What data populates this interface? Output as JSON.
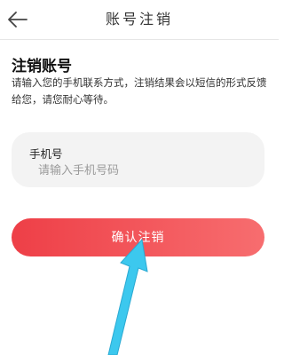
{
  "header": {
    "title": "账号注销",
    "back_icon": "back-arrow-icon"
  },
  "main": {
    "section_title": "注销账号",
    "description": "请输入您的手机联系方式，注销结果会以短信的形式反馈给您，请您耐心等待。"
  },
  "phone_field": {
    "label": "手机号",
    "placeholder": "请输入手机号码",
    "value": ""
  },
  "confirm_button": {
    "label": "确认注销"
  },
  "colors": {
    "button_gradient_start": "#ee3f47",
    "button_gradient_end": "#f76d6f",
    "annotation_arrow": "#3cc8ee"
  }
}
